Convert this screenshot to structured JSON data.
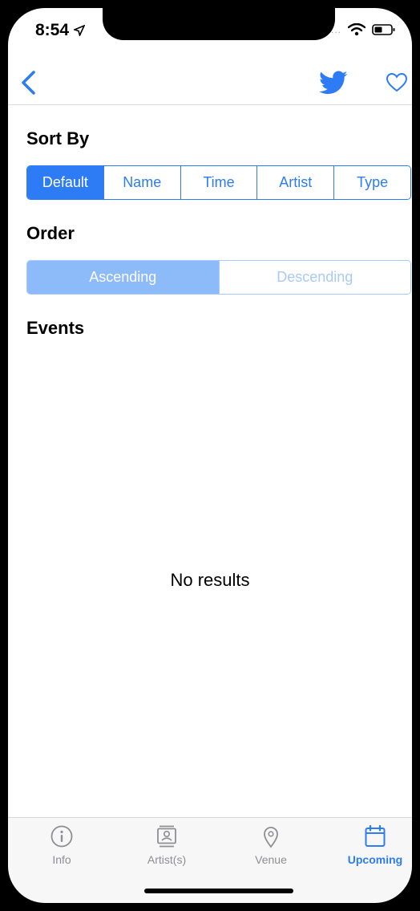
{
  "status": {
    "time": "8:54",
    "signal_dots": "....."
  },
  "nav": {
    "back_icon": "chevron-left-icon",
    "twitter_icon": "twitter-bird-icon",
    "favorite_icon": "heart-outline-icon"
  },
  "sort": {
    "title": "Sort By",
    "options": [
      "Default",
      "Name",
      "Time",
      "Artist",
      "Type"
    ],
    "selected": "Default"
  },
  "order": {
    "title": "Order",
    "options": [
      "Ascending",
      "Descending"
    ],
    "selected": "Ascending"
  },
  "events": {
    "title": "Events",
    "empty_text": "No results"
  },
  "tabbar": {
    "tabs": [
      {
        "label": "Info",
        "icon": "info-icon"
      },
      {
        "label": "Artist(s)",
        "icon": "artist-card-icon"
      },
      {
        "label": "Venue",
        "icon": "location-pin-icon"
      },
      {
        "label": "Upcoming",
        "icon": "calendar-icon"
      }
    ],
    "active": "Upcoming"
  },
  "colors": {
    "accent": "#2d7cf6",
    "accent_faded": "#a8c9fb",
    "twitter": "#1da1f2"
  }
}
